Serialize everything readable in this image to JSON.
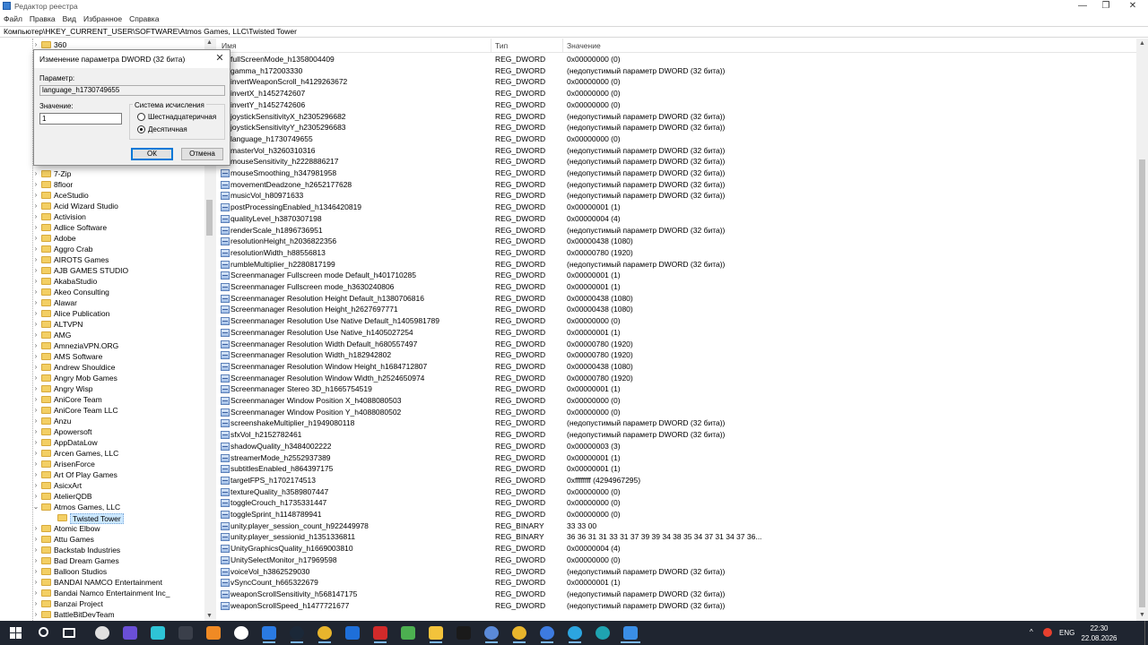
{
  "window": {
    "title": "Редактор реестра",
    "minimize": "—",
    "maximize": "❐",
    "close": "✕"
  },
  "menu": [
    "Файл",
    "Правка",
    "Вид",
    "Избранное",
    "Справка"
  ],
  "address": "Компьютер\\HKEY_CURRENT_USER\\SOFTWARE\\Atmos Games, LLC\\Twisted Tower",
  "tree": {
    "top_item": "360",
    "items": [
      "7-Zip",
      "8floor",
      "AceStudio",
      "Acid Wizard Studio",
      "Activision",
      "Adlice Software",
      "Adobe",
      "Aggro Crab",
      "AIROTS Games",
      "AJB GAMES STUDIO",
      "AkabaStudio",
      "Akeo Consulting",
      "Alawar",
      "Alice Publication",
      "ALTVPN",
      "AMG",
      "AmneziaVPN.ORG",
      "AMS Software",
      "Andrew Shouldice",
      "Angry Mob Games",
      "Angry Wisp",
      "AniCore Team",
      "AniCore Team LLC",
      "Anzu",
      "Apowersoft",
      "AppDataLow",
      "Arcen Games, LLC",
      "ArisenForce",
      "Art Of Play Games",
      "AsicxArt",
      "AtelierQDB",
      "Atmos Games, LLC"
    ],
    "child_selected": "Twisted Tower",
    "items_after": [
      "Atomic Elbow",
      "Attu Games",
      "Backstab Industries",
      "Bad Dream Games",
      "Balloon Studios",
      "BANDAI NAMCO Entertainment",
      "Bandai Namco Entertainment Inc_",
      "Banzai Project",
      "BattleBitDevTeam"
    ],
    "arrow_collapsed": "›",
    "arrow_expanded": "⌄",
    "scroll_up": "▲",
    "scroll_down": "▼"
  },
  "columns": {
    "name": "Имя",
    "type": "Тип",
    "value": "Значение"
  },
  "rows": [
    {
      "name": "fullScreenMode_h1358004409",
      "type": "REG_DWORD",
      "value": "0x00000000 (0)"
    },
    {
      "name": "gamma_h172003330",
      "type": "REG_DWORD",
      "value": "(недопустимый параметр DWORD (32 бита))"
    },
    {
      "name": "invertWeaponScroll_h4129263672",
      "type": "REG_DWORD",
      "value": "0x00000000 (0)"
    },
    {
      "name": "invertX_h1452742607",
      "type": "REG_DWORD",
      "value": "0x00000000 (0)"
    },
    {
      "name": "invertY_h1452742606",
      "type": "REG_DWORD",
      "value": "0x00000000 (0)"
    },
    {
      "name": "joystickSensitivityX_h2305296682",
      "type": "REG_DWORD",
      "value": "(недопустимый параметр DWORD (32 бита))"
    },
    {
      "name": "joystickSensitivityY_h2305296683",
      "type": "REG_DWORD",
      "value": "(недопустимый параметр DWORD (32 бита))"
    },
    {
      "name": "language_h1730749655",
      "type": "REG_DWORD",
      "value": "0x00000000 (0)"
    },
    {
      "name": "masterVol_h3260310316",
      "type": "REG_DWORD",
      "value": "(недопустимый параметр DWORD (32 бита))"
    },
    {
      "name": "mouseSensitivity_h2228886217",
      "type": "REG_DWORD",
      "value": "(недопустимый параметр DWORD (32 бита))"
    },
    {
      "name": "mouseSmoothing_h347981958",
      "type": "REG_DWORD",
      "value": "(недопустимый параметр DWORD (32 бита))"
    },
    {
      "name": "movementDeadzone_h2652177628",
      "type": "REG_DWORD",
      "value": "(недопустимый параметр DWORD (32 бита))"
    },
    {
      "name": "musicVol_h80971633",
      "type": "REG_DWORD",
      "value": "(недопустимый параметр DWORD (32 бита))"
    },
    {
      "name": "postProcessingEnabled_h1346420819",
      "type": "REG_DWORD",
      "value": "0x00000001 (1)"
    },
    {
      "name": "qualityLevel_h3870307198",
      "type": "REG_DWORD",
      "value": "0x00000004 (4)"
    },
    {
      "name": "renderScale_h1896736951",
      "type": "REG_DWORD",
      "value": "(недопустимый параметр DWORD (32 бита))"
    },
    {
      "name": "resolutionHeight_h2036822356",
      "type": "REG_DWORD",
      "value": "0x00000438 (1080)"
    },
    {
      "name": "resolutionWidth_h88556813",
      "type": "REG_DWORD",
      "value": "0x00000780 (1920)"
    },
    {
      "name": "rumbleMultiplier_h2280817199",
      "type": "REG_DWORD",
      "value": "(недопустимый параметр DWORD (32 бита))"
    },
    {
      "name": "Screenmanager Fullscreen mode Default_h401710285",
      "type": "REG_DWORD",
      "value": "0x00000001 (1)"
    },
    {
      "name": "Screenmanager Fullscreen mode_h3630240806",
      "type": "REG_DWORD",
      "value": "0x00000001 (1)"
    },
    {
      "name": "Screenmanager Resolution Height Default_h1380706816",
      "type": "REG_DWORD",
      "value": "0x00000438 (1080)"
    },
    {
      "name": "Screenmanager Resolution Height_h2627697771",
      "type": "REG_DWORD",
      "value": "0x00000438 (1080)"
    },
    {
      "name": "Screenmanager Resolution Use Native Default_h1405981789",
      "type": "REG_DWORD",
      "value": "0x00000000 (0)"
    },
    {
      "name": "Screenmanager Resolution Use Native_h1405027254",
      "type": "REG_DWORD",
      "value": "0x00000001 (1)"
    },
    {
      "name": "Screenmanager Resolution Width Default_h680557497",
      "type": "REG_DWORD",
      "value": "0x00000780 (1920)"
    },
    {
      "name": "Screenmanager Resolution Width_h182942802",
      "type": "REG_DWORD",
      "value": "0x00000780 (1920)"
    },
    {
      "name": "Screenmanager Resolution Window Height_h1684712807",
      "type": "REG_DWORD",
      "value": "0x00000438 (1080)"
    },
    {
      "name": "Screenmanager Resolution Window Width_h2524650974",
      "type": "REG_DWORD",
      "value": "0x00000780 (1920)"
    },
    {
      "name": "Screenmanager Stereo 3D_h1665754519",
      "type": "REG_DWORD",
      "value": "0x00000001 (1)"
    },
    {
      "name": "Screenmanager Window Position X_h4088080503",
      "type": "REG_DWORD",
      "value": "0x00000000 (0)"
    },
    {
      "name": "Screenmanager Window Position Y_h4088080502",
      "type": "REG_DWORD",
      "value": "0x00000000 (0)"
    },
    {
      "name": "screenshakeMultiplier_h1949080118",
      "type": "REG_DWORD",
      "value": "(недопустимый параметр DWORD (32 бита))"
    },
    {
      "name": "sfxVol_h2152782461",
      "type": "REG_DWORD",
      "value": "(недопустимый параметр DWORD (32 бита))"
    },
    {
      "name": "shadowQuality_h3484002222",
      "type": "REG_DWORD",
      "value": "0x00000003 (3)"
    },
    {
      "name": "streamerMode_h2552937389",
      "type": "REG_DWORD",
      "value": "0x00000001 (1)"
    },
    {
      "name": "subtitlesEnabled_h864397175",
      "type": "REG_DWORD",
      "value": "0x00000001 (1)"
    },
    {
      "name": "targetFPS_h1702174513",
      "type": "REG_DWORD",
      "value": "0xffffffff (4294967295)"
    },
    {
      "name": "textureQuality_h3589807447",
      "type": "REG_DWORD",
      "value": "0x00000000 (0)"
    },
    {
      "name": "toggleCrouch_h1735331447",
      "type": "REG_DWORD",
      "value": "0x00000000 (0)"
    },
    {
      "name": "toggleSprint_h1148789941",
      "type": "REG_DWORD",
      "value": "0x00000000 (0)"
    },
    {
      "name": "unity.player_session_count_h922449978",
      "type": "REG_BINARY",
      "value": "33 33 00"
    },
    {
      "name": "unity.player_sessionid_h1351336811",
      "type": "REG_BINARY",
      "value": "36 36 31 31 33 31 37 39 39 34 38 35 34 37 31 34 37 36..."
    },
    {
      "name": "UnityGraphicsQuality_h1669003810",
      "type": "REG_DWORD",
      "value": "0x00000004 (4)"
    },
    {
      "name": "UnitySelectMonitor_h17969598",
      "type": "REG_DWORD",
      "value": "0x00000000 (0)"
    },
    {
      "name": "voiceVol_h3862529030",
      "type": "REG_DWORD",
      "value": "(недопустимый параметр DWORD (32 бита))"
    },
    {
      "name": "vSyncCount_h665322679",
      "type": "REG_DWORD",
      "value": "0x00000001 (1)"
    },
    {
      "name": "weaponScrollSensitivity_h568147175",
      "type": "REG_DWORD",
      "value": "(недопустимый параметр DWORD (32 бита))"
    },
    {
      "name": "weaponScrollSpeed_h1477721677",
      "type": "REG_DWORD",
      "value": "(недопустимый параметр DWORD (32 бита))"
    }
  ],
  "dialog": {
    "title": "Изменение параметра DWORD (32 бита)",
    "close": "✕",
    "param_label": "Параметр:",
    "param_value": "language_h1730749655",
    "value_label": "Значение:",
    "value": "1",
    "base_label": "Система исчисления",
    "hex_label": "Шестнадцатеричная",
    "dec_label": "Десятичная",
    "selected_base": "decimal",
    "ok": "ОК",
    "cancel": "Отмена"
  },
  "taskbar": {
    "icons": [
      {
        "name": "search-icon",
        "color": "#1f2530"
      },
      {
        "name": "task-view-icon",
        "color": "#1f2530"
      },
      {
        "name": "unreal-icon",
        "color": "#e0e0e0"
      },
      {
        "name": "purple-app-icon",
        "color": "#6a4fd6"
      },
      {
        "name": "obsidian-icon",
        "color": "#2ec4d6"
      },
      {
        "name": "epic-icon",
        "color": "#3a3f4a"
      },
      {
        "name": "fox-icon",
        "color": "#f08a24"
      },
      {
        "name": "yandex-browser-icon",
        "color": "#ffffff"
      },
      {
        "name": "files-icon",
        "color": "#2a7ae2"
      },
      {
        "name": "steam-icon",
        "color": "#1b2838"
      },
      {
        "name": "chrome-icon",
        "color": "#e8b52c"
      },
      {
        "name": "blue-app-icon",
        "color": "#1e6fd9"
      },
      {
        "name": "opera-gx-icon",
        "color": "#d12a2a"
      },
      {
        "name": "notepad-icon",
        "color": "#4caf50"
      },
      {
        "name": "explorer-icon",
        "color": "#f3c33b"
      },
      {
        "name": "capcut-icon",
        "color": "#1a1a1a"
      },
      {
        "name": "vpn-icon",
        "color": "#5b8ad8"
      },
      {
        "name": "chrome2-icon",
        "color": "#e8b52c"
      },
      {
        "name": "notepadpp-icon",
        "color": "#3d7be0"
      },
      {
        "name": "telegram-icon",
        "color": "#2ca5e0"
      },
      {
        "name": "edge-icon",
        "color": "#1fa3b0"
      },
      {
        "name": "regedit-icon",
        "color": "#3a8ee6"
      }
    ],
    "tray_chevron": "^",
    "language": "ENG",
    "time": "22:30",
    "date": "22.08.2026"
  }
}
